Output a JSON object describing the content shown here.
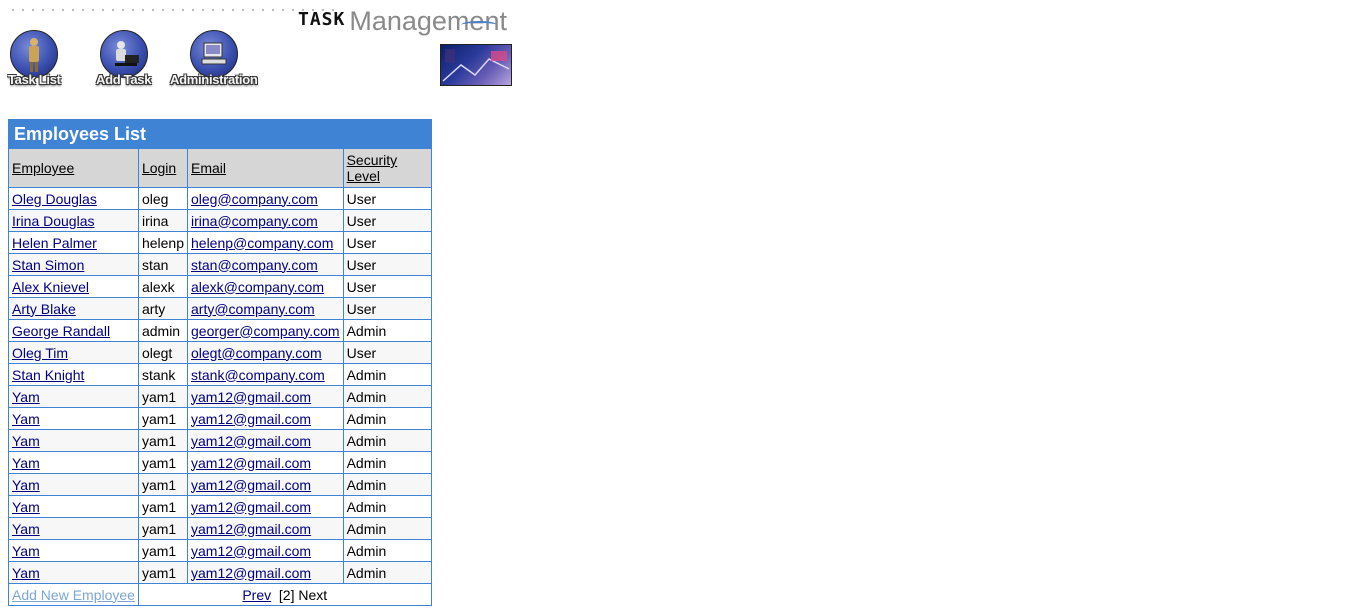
{
  "header": {
    "logo_task": "TASK",
    "logo_management": "Management",
    "nav": [
      {
        "label": "Task List",
        "icon": "task-list-icon"
      },
      {
        "label": "Add Task",
        "icon": "add-task-icon"
      },
      {
        "label": "Administration",
        "icon": "administration-icon"
      }
    ],
    "banner_icon": "banner-image"
  },
  "table": {
    "title": "Employees List",
    "columns": [
      "Employee",
      "Login",
      "Email",
      "Security Level"
    ],
    "rows": [
      {
        "employee": "Oleg Douglas",
        "login": "oleg",
        "email": "oleg@company.com",
        "level": "User"
      },
      {
        "employee": "Irina Douglas",
        "login": "irina",
        "email": "irina@company.com",
        "level": "User"
      },
      {
        "employee": "Helen Palmer",
        "login": "helenp",
        "email": "helenp@company.com",
        "level": "User"
      },
      {
        "employee": "Stan Simon",
        "login": "stan",
        "email": "stan@company.com",
        "level": "User"
      },
      {
        "employee": "Alex Knievel",
        "login": "alexk",
        "email": "alexk@company.com",
        "level": "User"
      },
      {
        "employee": "Arty Blake",
        "login": "arty",
        "email": "arty@company.com",
        "level": "User"
      },
      {
        "employee": "George Randall",
        "login": "admin",
        "email": "georger@company.com",
        "level": "Admin"
      },
      {
        "employee": "Oleg Tim",
        "login": "olegt",
        "email": "olegt@company.com",
        "level": "User"
      },
      {
        "employee": "Stan Knight",
        "login": "stank",
        "email": "stank@company.com",
        "level": "Admin"
      },
      {
        "employee": "Yam",
        "login": "yam1",
        "email": "yam12@gmail.com",
        "level": "Admin"
      },
      {
        "employee": "Yam",
        "login": "yam1",
        "email": "yam12@gmail.com",
        "level": "Admin"
      },
      {
        "employee": "Yam",
        "login": "yam1",
        "email": "yam12@gmail.com",
        "level": "Admin"
      },
      {
        "employee": "Yam",
        "login": "yam1",
        "email": "yam12@gmail.com",
        "level": "Admin"
      },
      {
        "employee": "Yam",
        "login": "yam1",
        "email": "yam12@gmail.com",
        "level": "Admin"
      },
      {
        "employee": "Yam",
        "login": "yam1",
        "email": "yam12@gmail.com",
        "level": "Admin"
      },
      {
        "employee": "Yam",
        "login": "yam1",
        "email": "yam12@gmail.com",
        "level": "Admin"
      },
      {
        "employee": "Yam",
        "login": "yam1",
        "email": "yam12@gmail.com",
        "level": "Admin"
      },
      {
        "employee": "Yam",
        "login": "yam1",
        "email": "yam12@gmail.com",
        "level": "Admin"
      }
    ],
    "footer": {
      "add_new": "Add New Employee",
      "prev": "Prev",
      "current_page": "[2]",
      "next": "Next"
    }
  },
  "colors": {
    "accent": "#3f83d4",
    "link": "#000080",
    "header_bg": "#d6d6d6"
  }
}
